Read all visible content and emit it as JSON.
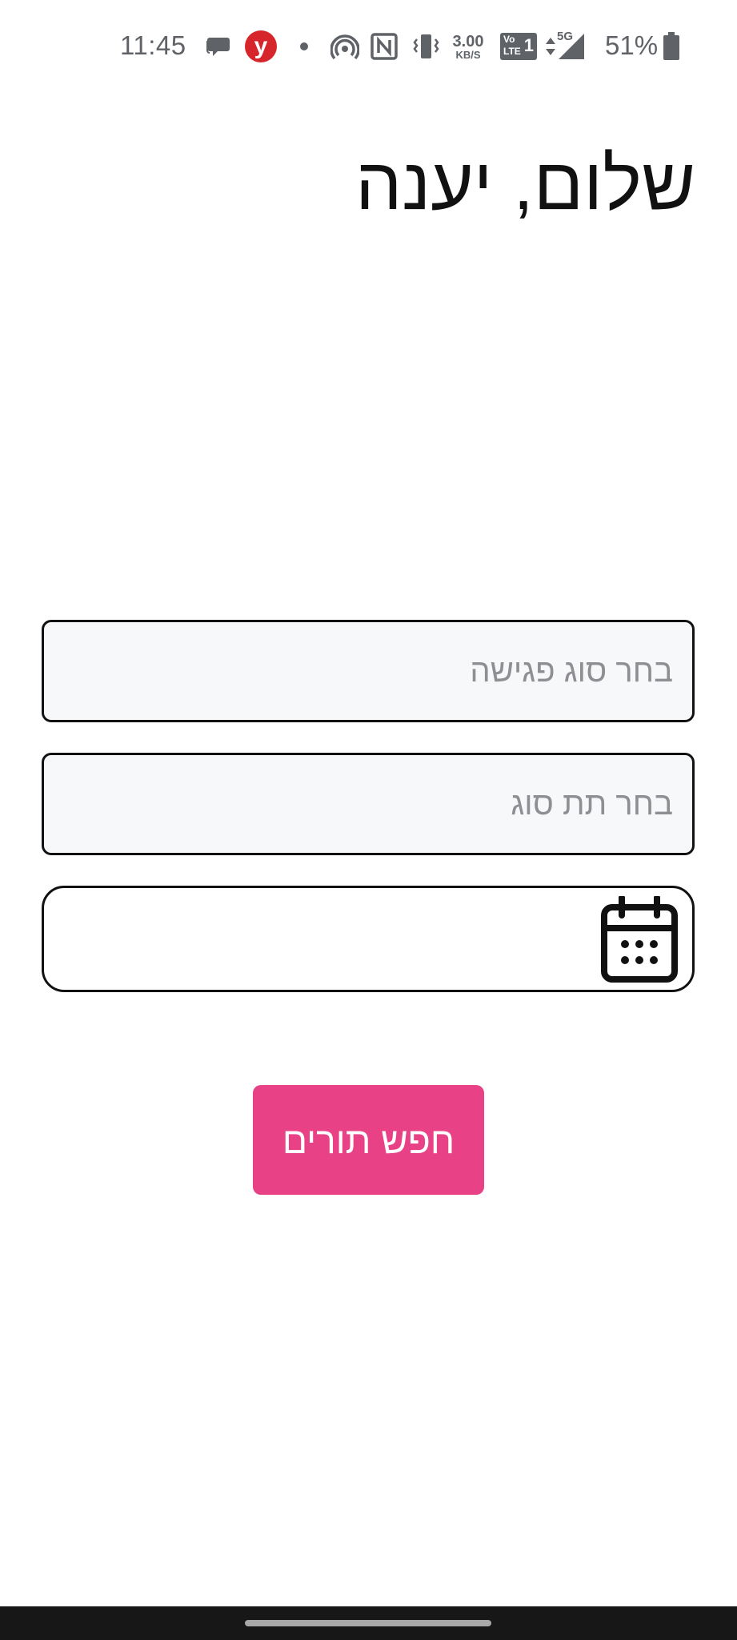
{
  "status_bar": {
    "time": "11:45",
    "network_speed_value": "3.00",
    "network_speed_unit": "KB/S",
    "volte_label": "Vo",
    "lte_label": "LTE",
    "sim_number": "1",
    "network_type": "5G",
    "battery_percent": "51%",
    "app_badge_letter": "y",
    "icons": [
      "chat-icon",
      "ynet-app-icon",
      "dot-icon",
      "hotspot-icon",
      "nfc-icon",
      "vibrate-icon",
      "network-speed-icon",
      "volte-icon",
      "data-arrows-icon",
      "signal-icon",
      "battery-icon"
    ]
  },
  "greeting": {
    "text": "שלום, יענה"
  },
  "form": {
    "meeting_type": {
      "placeholder": "בחר סוג פגישה"
    },
    "sub_type": {
      "placeholder": "בחר תת סוג"
    },
    "date": {
      "value": "",
      "icon": "calendar-icon"
    },
    "search_button_label": "חפש תורים"
  },
  "colors": {
    "accent": "#e84185",
    "field_border": "#111111",
    "field_background": "#f7f8fa",
    "placeholder_text": "#8e8e93",
    "status_icons": "#5f6368",
    "nav_bar": "#171717"
  }
}
